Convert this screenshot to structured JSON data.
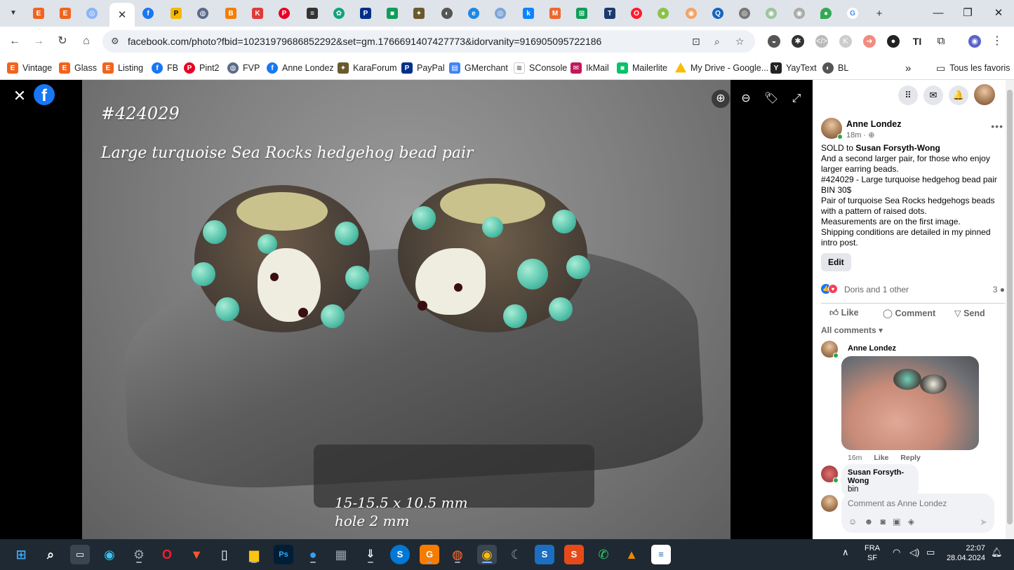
{
  "browser": {
    "active_tab_close": "✕",
    "tab_favicons": [
      "etsy",
      "etsy",
      "google-lens",
      "facebook",
      "plus-badge",
      "fvp",
      "blogger",
      "ko-kasi",
      "pinterest",
      "karaforum",
      "openai",
      "paypal",
      "gmerchant",
      "turtle",
      "coin",
      "edge",
      "fvp-2",
      "kook",
      "magento",
      "google-sheets",
      "t-icon",
      "opera",
      "kara",
      "chrome-1",
      "search-q",
      "camera",
      "chrome-2",
      "chrome-3",
      "maps",
      "google"
    ],
    "new_tab": "+",
    "url": "facebook.com/photo?fbid=10231979686852292&set=gm.1766691407427773&idorvanity=916905095722186",
    "bookmarks": [
      {
        "label": "Vintage",
        "icon": "etsy-icon"
      },
      {
        "label": "Glass",
        "icon": "etsy-icon"
      },
      {
        "label": "Listing",
        "icon": "etsy-icon"
      },
      {
        "label": "FB",
        "icon": "facebook-icon"
      },
      {
        "label": "Pint2",
        "icon": "pinterest-icon"
      },
      {
        "label": "FVP",
        "icon": "fvp-icon"
      },
      {
        "label": "Anne Londez",
        "icon": "facebook-icon"
      },
      {
        "label": "KaraForum",
        "icon": "turtle-icon"
      },
      {
        "label": "PayPal",
        "icon": "paypal-icon"
      },
      {
        "label": "GMerchant",
        "icon": "merchant-icon"
      },
      {
        "label": "SConsole",
        "icon": "search-console-icon"
      },
      {
        "label": "IkMail",
        "icon": "ikmail-icon"
      },
      {
        "label": "Mailerlite",
        "icon": "mailerlite-icon"
      },
      {
        "label": "My Drive - Google...",
        "icon": "drive-icon"
      },
      {
        "label": "YayText",
        "icon": "yaytext-icon"
      },
      {
        "label": "BL",
        "icon": "globe-icon"
      }
    ],
    "bookmarks_more": "»",
    "all_bookmarks": "Tous les favoris"
  },
  "photo": {
    "code": "#424029",
    "title": "Large turquoise Sea Rocks hedgehog bead pair",
    "dim_line1": "15-15.5 x 10.5 mm",
    "dim_line2": "hole 2 mm"
  },
  "post": {
    "author": "Anne Londez",
    "time": "18m · ",
    "more": "•••",
    "sold_prefix": "SOLD to ",
    "sold_to": "Susan Forsyth-Wong",
    "lines": [
      "And a second larger pair, for those who enjoy larger earring beads.",
      "#424029 - Large turquoise hedgehog bead pair",
      "BIN 30$",
      "Pair of turquoise Sea Rocks hedgehogs beads with a pattern of raised dots.",
      "Measurements are on the first image.",
      "Shipping conditions are detailed in my pinned intro post."
    ],
    "edit_label": "Edit",
    "reactions_names": "Doris and 1 other",
    "comments_count": "3",
    "actions": {
      "like": "Like",
      "comment": "Comment",
      "send": "Send"
    },
    "all_comments": "All comments ▾"
  },
  "comments": [
    {
      "author": "Anne Londez",
      "time": "16m",
      "like": "Like",
      "reply": "Reply"
    },
    {
      "author": "Susan Forsyth-Wong",
      "text": "bin"
    }
  ],
  "composer": {
    "placeholder": "Comment as Anne Londez"
  },
  "taskbar": {
    "lang1": "FRA",
    "lang2": "SF",
    "time": "22:07",
    "date": "28.04.2024"
  }
}
